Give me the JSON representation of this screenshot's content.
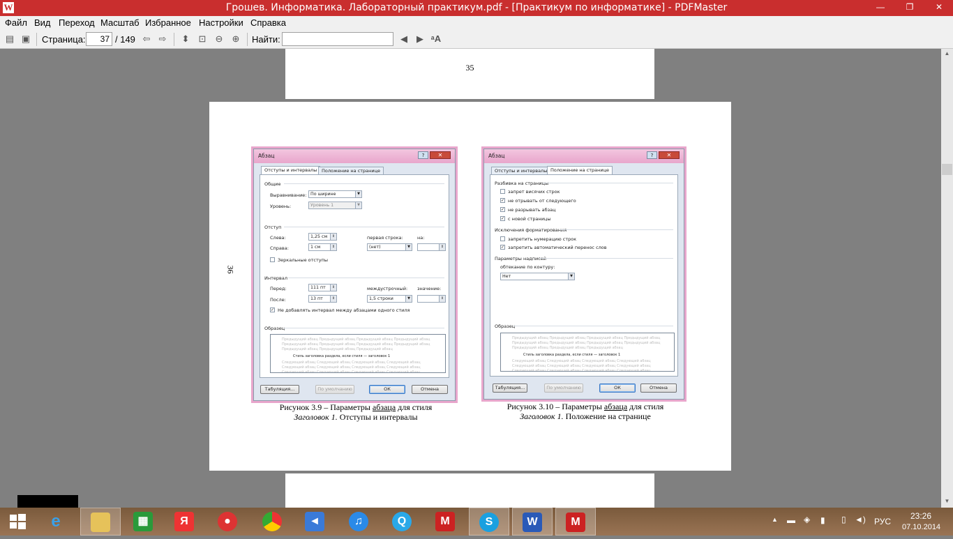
{
  "window": {
    "title": "Грошев. Информатика. Лабораторный практикум.pdf - [Практикум по информатике] - PDFMaster",
    "logo_letter": "W",
    "minimize": "—",
    "restore": "❐",
    "close": "✕"
  },
  "menu": [
    "Файл",
    "Вид",
    "Переход",
    "Масштаб",
    "Избранное",
    "Настройки",
    "Справка"
  ],
  "toolbar": {
    "page_label": "Страница:",
    "page_current": "37",
    "page_total": "/ 149",
    "find_label": "Найти:",
    "find_value": ""
  },
  "pages": {
    "page_top_number": "35",
    "page_mid_number": "36"
  },
  "dialog_left": {
    "title": "Абзац",
    "help": "?",
    "close": "✕",
    "tab_active": "Отступы и интервалы",
    "tab_inactive": "Положение на странице",
    "section_general": "Общие",
    "align_label": "Выравнивание:",
    "align_value": "По ширине",
    "level_label": "Уровень:",
    "level_value": "Уровень 1",
    "section_indent": "Отступ",
    "left_label": "Слева:",
    "left_value": "1,25 см",
    "right_label": "Справа:",
    "right_value": "1 см",
    "first_line_label": "первая строка:",
    "first_line_value": "(нет)",
    "on_label": "на:",
    "mirror_label": "Зеркальные отступы",
    "section_interval": "Интервал",
    "before_label": "Перед:",
    "before_value": "111 пт",
    "after_label": "После:",
    "after_value": "13 пт",
    "line_spacing_label": "междустрочный:",
    "line_spacing_value": "1,5 строки",
    "value_label": "значение:",
    "no_space_label": "Не добавлять интервал между абзацами одного стиля",
    "section_sample": "Образец",
    "sample_before": "Предыдущий абзац Предыдущий абзац Предыдущий абзац Предыдущий абзац Предыдущий абзац Предыдущий абзац Предыдущий абзац Предыдущий абзац Предыдущий абзац Предыдущий абзац Предыдущий абзац",
    "sample_main": "Стиль заголовка раздела, если стиля — заголовок 1",
    "sample_after": "Следующий абзац Следующий абзац Следующий абзац Следующий абзац Следующий абзац Следующий абзац Следующий абзац Следующий абзац Следующий абзац Следующий абзац Следующий абзац Следующий абзац",
    "btn_tabs": "Табуляция...",
    "btn_default": "По умолчанию",
    "btn_ok": "ОК",
    "btn_cancel": "Отмена"
  },
  "dialog_right": {
    "title": "Абзац",
    "help": "?",
    "close": "✕",
    "tab_inactive": "Отступы и интервалы",
    "tab_active": "Положение на странице",
    "section_pagination": "Разбивка на страницы",
    "widow_label": "запрет висячих строк",
    "keep_next_label": "не отрывать от следующего",
    "keep_lines_label": "не разрывать абзац",
    "page_break_label": "с новой страницы",
    "section_exceptions": "Исключения форматирования",
    "suppress_numbers_label": "запретить нумерацию строк",
    "no_hyphen_label": "запретить автоматический перенос слов",
    "section_textbox": "Параметры надписей",
    "wrap_label": "обтекание по контуру:",
    "wrap_value": "Нет",
    "section_sample": "Образец",
    "sample_before": "Предыдущий абзац Предыдущий абзац Предыдущий абзац Предыдущий абзац Предыдущий абзац Предыдущий абзац Предыдущий абзац Предыдущий абзац Предыдущий абзац Предыдущий абзац Предыдущий абзац",
    "sample_main": "Стиль заголовка раздела, если стиля — заголовок 1",
    "sample_after": "Следующий абзац Следующий абзац Следующий абзац Следующий абзац Следующий абзац Следующий абзац Следующий абзац Следующий абзац Следующий абзац Следующий абзац Следующий абзац Следующий абзац",
    "btn_tabs": "Табуляция...",
    "btn_default": "По умолчанию",
    "btn_ok": "ОК",
    "btn_cancel": "Отмена"
  },
  "caption_left": {
    "line1_pre": "Рисунок 3.9 – Параметры ",
    "line1_link": "абзаца",
    "line1_post": " для стиля",
    "line2_italic": "Заголовок 1.",
    "line2_rest": " Отступы и интервалы"
  },
  "caption_right": {
    "line1_pre": "Рисунок 3.10 – Параметры ",
    "line1_link": "абзаца",
    "line1_post": " для стиля",
    "line2_italic": "Заголовок 1.",
    "line2_rest": " Положение на странице"
  },
  "taskbar": {
    "language": "РУС",
    "time": "23:26",
    "date": "07.10.2014"
  },
  "colors": {
    "titlebar": "#c92e2e",
    "dialog_border": "#e8a6cc",
    "taskbar": "#8a6848"
  }
}
